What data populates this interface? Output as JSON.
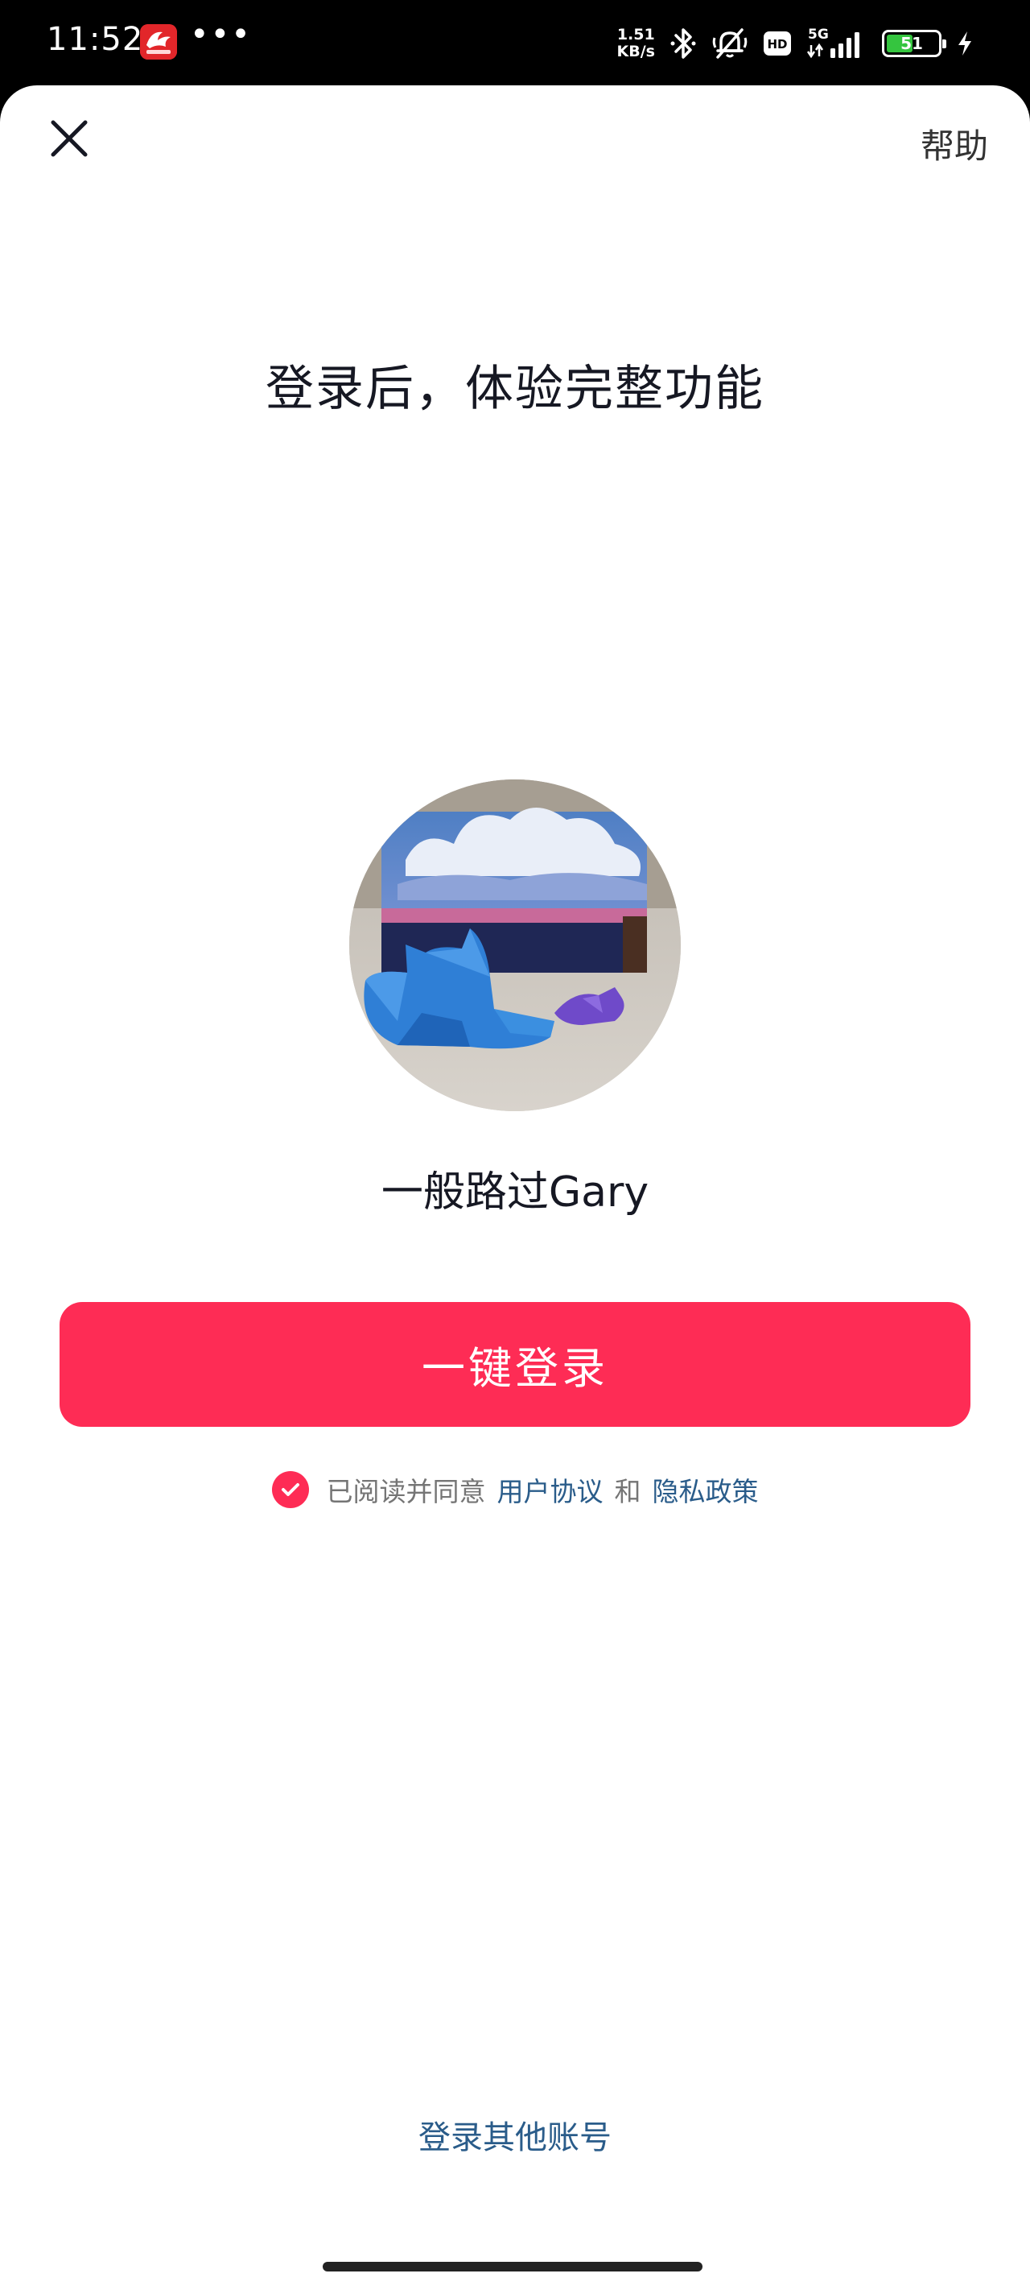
{
  "status_bar": {
    "time": "11:52",
    "dots": "•••",
    "net_speed_value": "1.51",
    "net_speed_unit": "KB/s",
    "network_type": "5G",
    "hd_label": "HD",
    "battery_level": "51",
    "battery_fraction": 0.51
  },
  "header": {
    "help_label": "帮助"
  },
  "main": {
    "headline": "登录后，体验完整功能",
    "username": "一般路过Gary",
    "login_button_label": "一键登录",
    "agreement": {
      "prefix": "已阅读并同意",
      "terms_link": "用户协议",
      "conjunction": "和",
      "privacy_link": "隐私政策",
      "checked": true
    },
    "other_account_label": "登录其他账号"
  },
  "colors": {
    "accent": "#fe2c55",
    "link": "#2a5c8a",
    "text_primary": "#161823",
    "text_secondary": "#757575",
    "battery_green": "#35c53f"
  },
  "icons": {
    "close": "close-icon",
    "check": "check-icon",
    "bluetooth": "bluetooth-icon",
    "mute": "bell-off-icon",
    "signal": "signal-icon",
    "charging": "bolt-icon"
  }
}
